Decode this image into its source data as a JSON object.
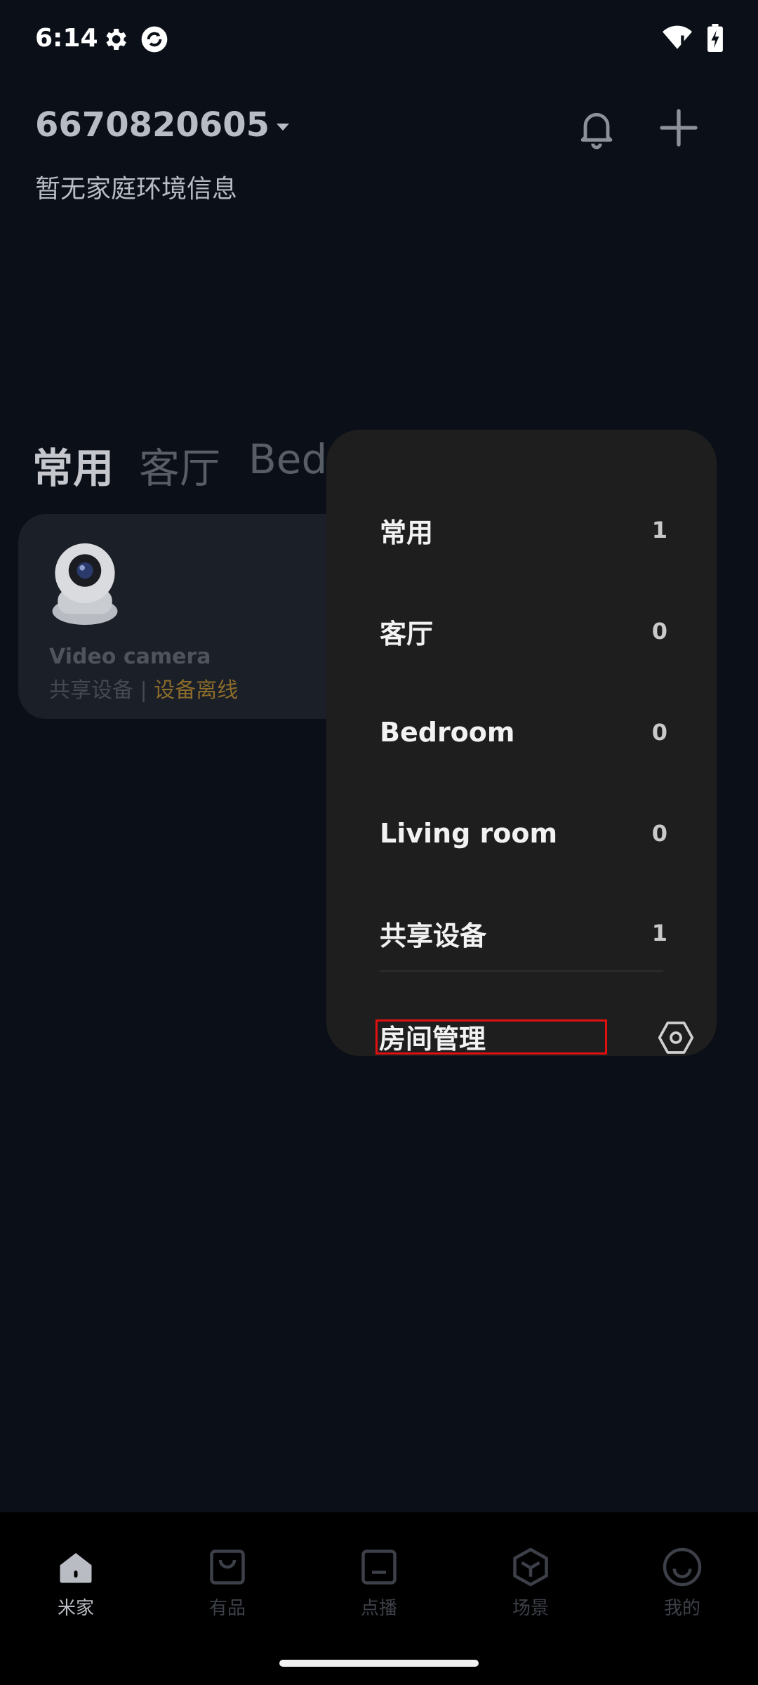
{
  "status_bar": {
    "time": "6:14"
  },
  "header": {
    "home_name": "6670820605",
    "env_info": "暂无家庭环境信息"
  },
  "tabs": [
    {
      "label": "常用",
      "active": true
    },
    {
      "label": "客厅",
      "active": false
    },
    {
      "label": "Bedr",
      "active": false
    }
  ],
  "device": {
    "name": "Video camera",
    "shared_label": "共享设备",
    "separator": "|",
    "status": "设备离线",
    "status_color": "#8c6c2a"
  },
  "room_dropdown": {
    "rooms": [
      {
        "name": "常用",
        "count": "1"
      },
      {
        "name": "客厅",
        "count": "0"
      },
      {
        "name": "Bedroom",
        "count": "0"
      },
      {
        "name": "Living room",
        "count": "0"
      },
      {
        "name": "共享设备",
        "count": "1"
      }
    ],
    "manage_label": "房间管理"
  },
  "bottom_nav": [
    {
      "label": "米家",
      "icon": "home-icon",
      "active": true
    },
    {
      "label": "有品",
      "icon": "shopping-bag-icon",
      "active": false
    },
    {
      "label": "点播",
      "icon": "media-icon",
      "active": false
    },
    {
      "label": "场景",
      "icon": "scene-cube-icon",
      "active": false
    },
    {
      "label": "我的",
      "icon": "profile-smile-icon",
      "active": false
    }
  ],
  "colors": {
    "background": "#0b1018",
    "dropdown_bg": "#1e1e1e",
    "highlight_box": "#e01010"
  }
}
